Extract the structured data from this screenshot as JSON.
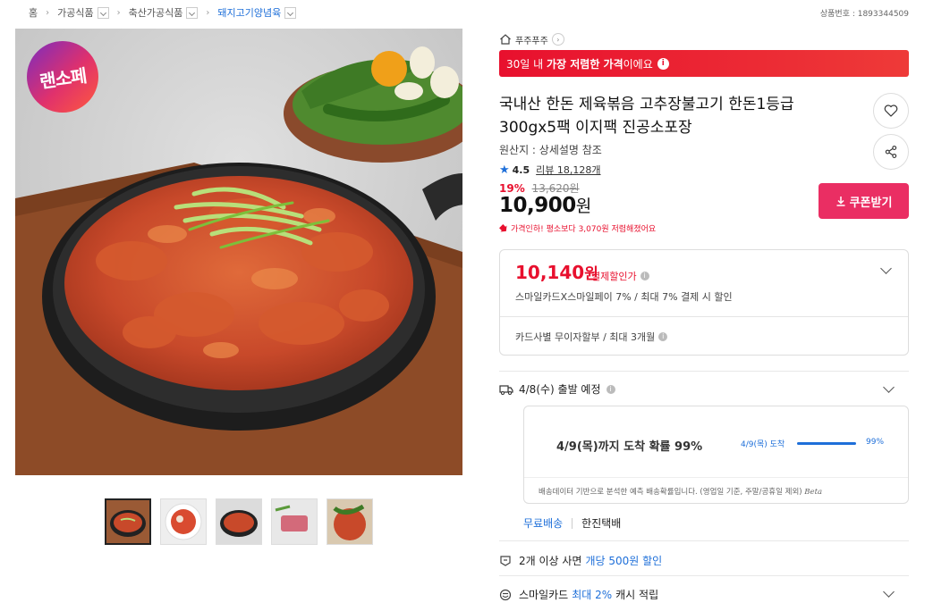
{
  "breadcrumb": {
    "items": [
      "홈",
      "가공식품",
      "축산가공식품",
      "돼지고기양념육"
    ]
  },
  "product_number": "상품번호 : 1893344509",
  "brand_logo_text": "랜소페",
  "store": {
    "name": "푸주푸주"
  },
  "promo_banner": {
    "pre": "30일 내",
    "bold": "가장 저렴한 가격",
    "post": "이에요",
    "info": "i"
  },
  "product": {
    "title_line1": "국내산 한돈 제육볶음 고추장불고기 한돈1등급",
    "title_line2": "300gx5팩 이지팩 진공소포장",
    "origin": "원산지 : 상세설명 참조",
    "rating": "4.5",
    "reviews": "리뷰 18,128개",
    "discount_rate": "19%",
    "original_price": "13,620원",
    "price_number": "10,900",
    "price_unit": "원",
    "price_note": "가격인하! 평소보다 3,070원 저렴해졌어요"
  },
  "coupon_button": {
    "label": "쿠폰받기"
  },
  "payment": {
    "price_number": "10,140",
    "price_unit": "원",
    "label": "결제할인가",
    "desc": "스마일카드X스마일페이 7% / 최대 7% 결제 시 할인",
    "installment": "카드사별 무이자할부 / 최대 3개월"
  },
  "shipping": {
    "departure": "4/8(수) 출발 예정",
    "probability_headline": "4/9(목)까지 도착 확률 99%",
    "arrival_label": "4/9(목) 도착",
    "arrival_pct": "99%",
    "arrival_fraction": 0.99,
    "footnote": "배송데이터 기반으로 분석한 예측 배송확률입니다. (영업일 기준, 주말/공휴일 제외)",
    "beta": "Beta",
    "free": "무료배송",
    "carrier": "한진택배"
  },
  "benefits": {
    "bulk_pre": "2개 이상 사면",
    "bulk_blue": "개당 500원 할인",
    "cash_pre": "스마일카드",
    "cash_blue": "최대 2%",
    "cash_post": "캐시 적립"
  },
  "icons": [
    "home-icon",
    "chevron-right-icon",
    "heart-icon",
    "share-icon",
    "star-icon",
    "download-icon",
    "truck-icon",
    "chevron-down-icon",
    "tag-icon",
    "smile-icon"
  ],
  "colors": {
    "accent_red": "#e8102e",
    "coupon_pink": "#ea2e63",
    "link_blue": "#1e6fd9"
  }
}
